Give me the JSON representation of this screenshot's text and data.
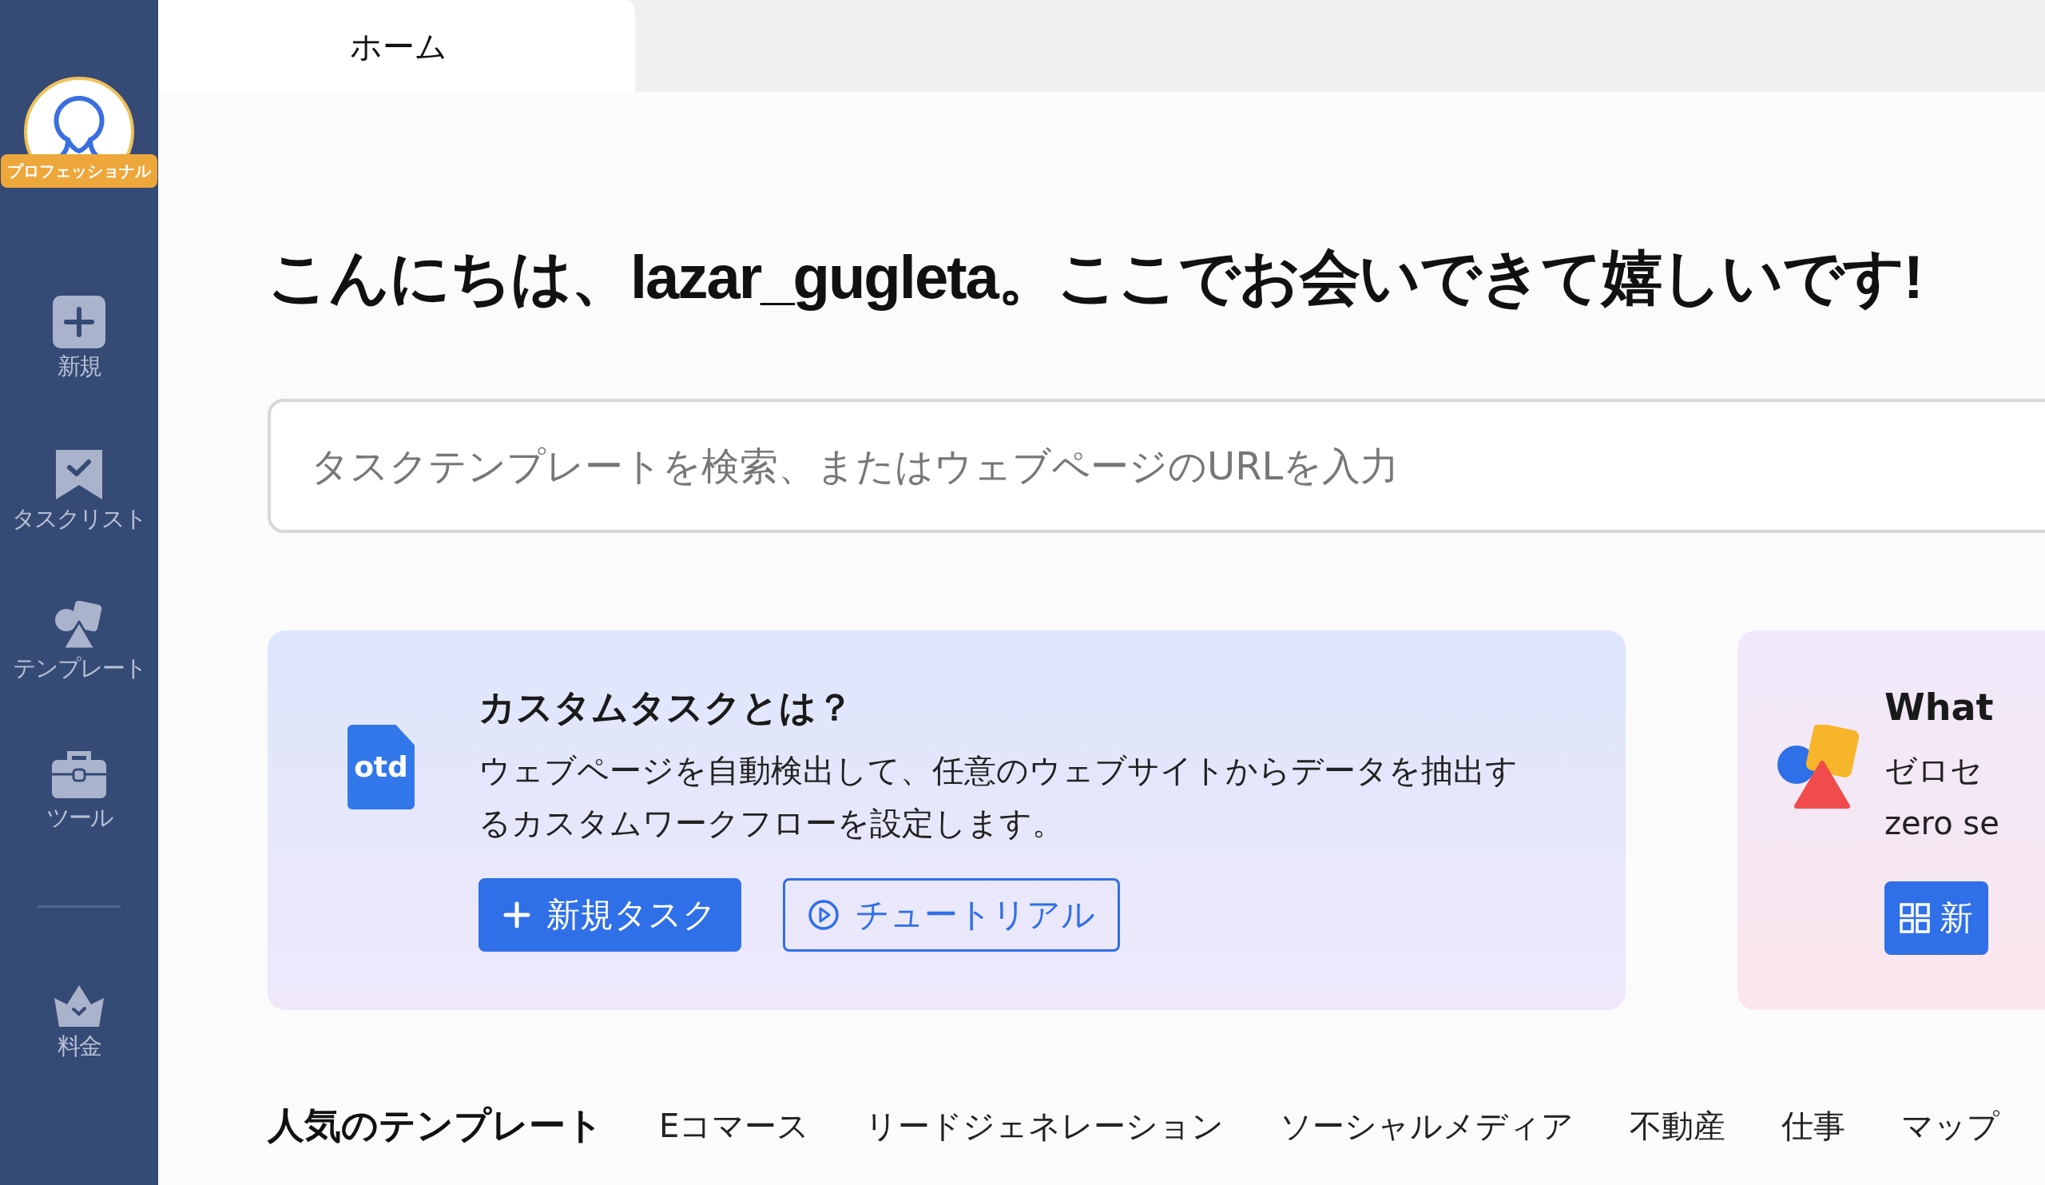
{
  "sidebar": {
    "badge": "プロフェッショナル",
    "items": [
      {
        "kind": "new",
        "label": "新規"
      },
      {
        "kind": "tasklist",
        "label": "タスクリスト"
      },
      {
        "kind": "template",
        "label": "テンプレート"
      },
      {
        "kind": "tools",
        "label": "ツール"
      }
    ],
    "footer_items": [
      {
        "kind": "pricing",
        "label": "料金"
      }
    ]
  },
  "tabs": [
    {
      "label": "ホーム",
      "selected": true
    }
  ],
  "greeting": "こんにちは、lazar_gugleta。ここでお会いできて嬉しいです!",
  "search": {
    "placeholder": "タスクテンプレートを検索、またはウェブページのURLを入力"
  },
  "cards": [
    {
      "kind": "custom",
      "file_label": "otd",
      "title": "カスタムタスクとは？",
      "description": "ウェブページを自動検出して、任意のウェブサイトからデータを抽出するカスタムワークフローを設定します。",
      "buttons": [
        {
          "kind": "primary",
          "label": "新規タスク"
        },
        {
          "kind": "outline",
          "label": "チュートリアル"
        }
      ]
    },
    {
      "kind": "template",
      "title": "What",
      "description": "ゼロセ",
      "subtext": "zero se",
      "buttons": [
        {
          "kind": "primary",
          "label": "新"
        }
      ]
    }
  ],
  "template_tabs": {
    "title": "人気のテンプレート",
    "items": [
      {
        "label": "Eコマース"
      },
      {
        "label": "リードジェネレーション"
      },
      {
        "label": "ソーシャルメディア"
      },
      {
        "label": "不動産"
      },
      {
        "label": "仕事"
      },
      {
        "label": "マップ"
      }
    ]
  }
}
